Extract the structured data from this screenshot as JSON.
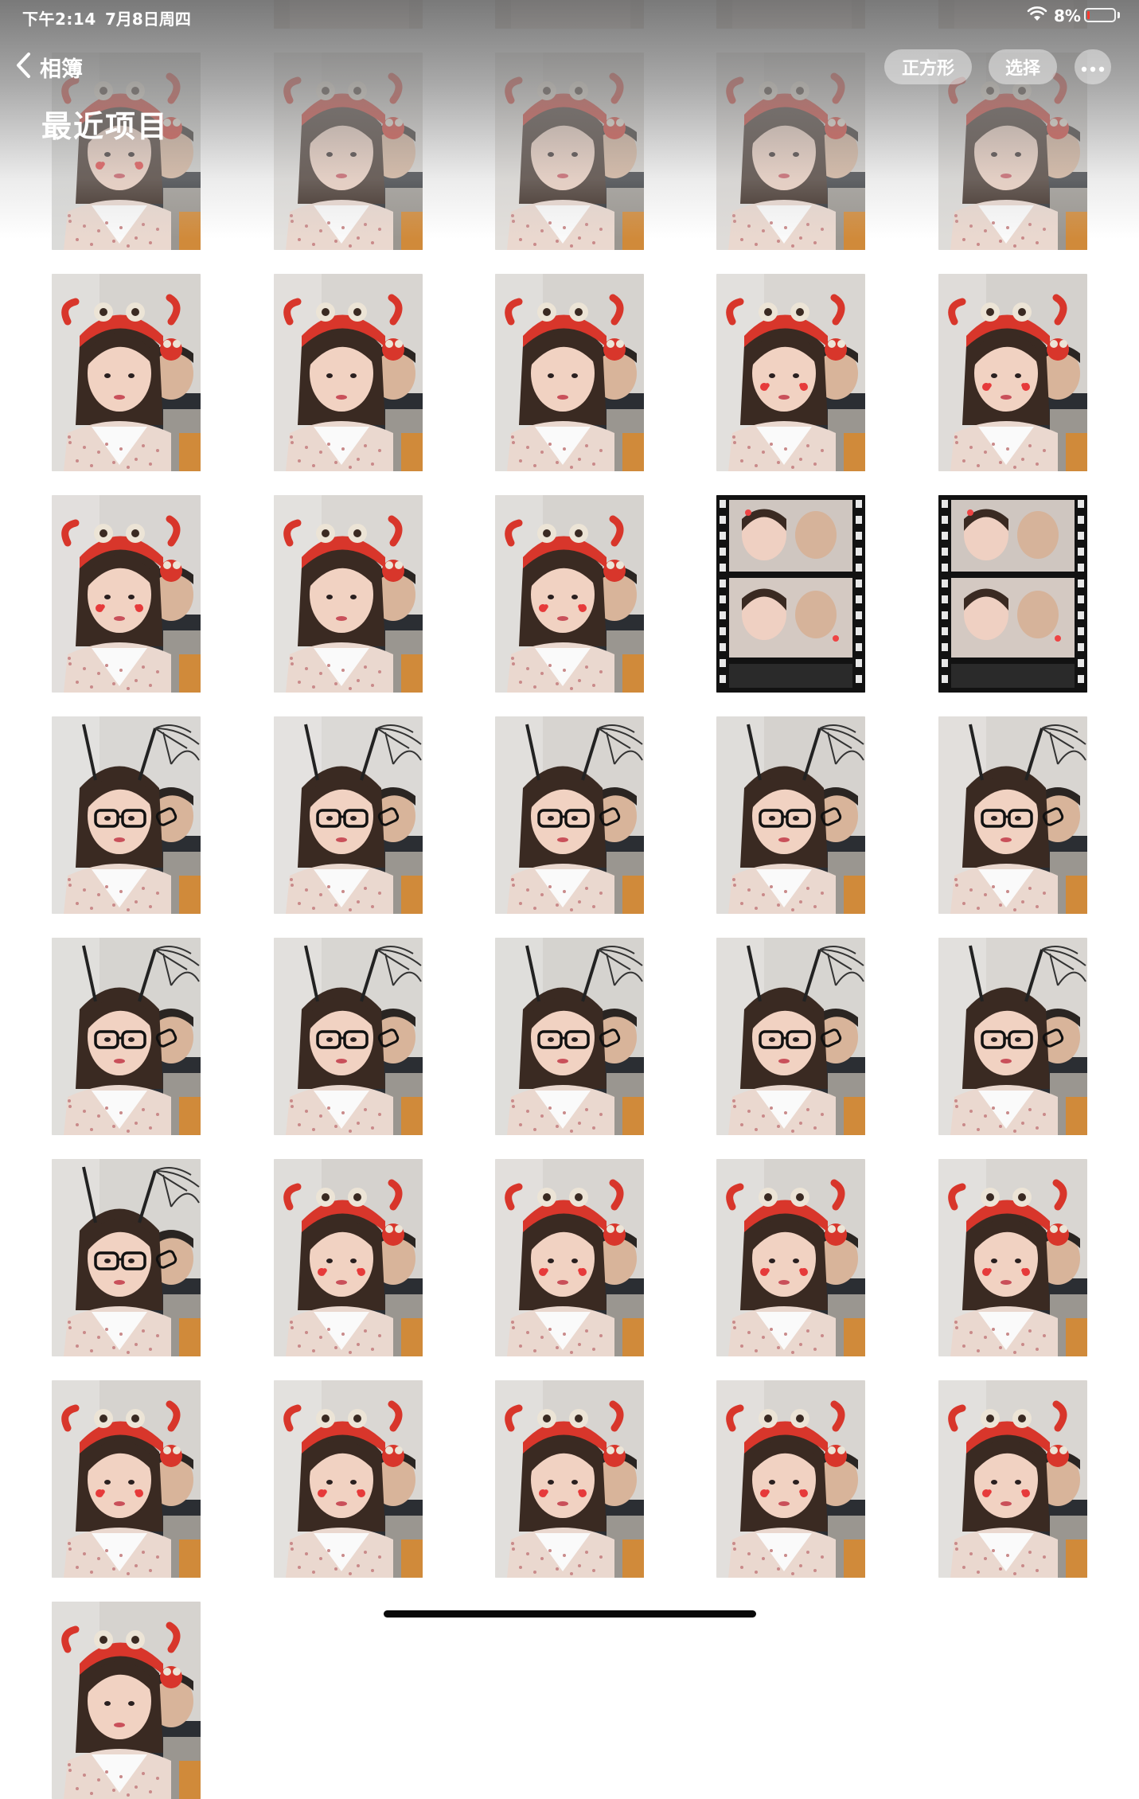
{
  "status_bar": {
    "time": "下午2:14",
    "date": "7月8日周四",
    "battery": "8%",
    "wifi_icon": "wifi-icon",
    "battery_icon": "battery-icon",
    "battery_level": 0.08
  },
  "nav": {
    "back_label": "相簿",
    "back_icon": "chevron-left-icon",
    "title": "最近项目",
    "square_label": "正方形",
    "select_label": "选择",
    "more_icon": "ellipsis-icon"
  },
  "photos": [
    {
      "style": "crab-cheeks",
      "bg": "#cfcfcc"
    },
    {
      "style": "crab",
      "bg": "#d9d6d2"
    },
    {
      "style": "crab",
      "bg": "#d8d4cf"
    },
    {
      "style": "crab",
      "bg": "#d4d1cd"
    },
    {
      "style": "crab",
      "bg": "#d3d0cc"
    },
    {
      "style": "crab",
      "bg": "#d6d3cf"
    },
    {
      "style": "crab",
      "bg": "#d8d5d1"
    },
    {
      "style": "crab",
      "bg": "#d6d3cf"
    },
    {
      "style": "crab-cheeks",
      "bg": "#d9d6d2"
    },
    {
      "style": "crab-cheeks",
      "bg": "#d4d1cd"
    },
    {
      "style": "crab-cheeks",
      "bg": "#d8d5d2"
    },
    {
      "style": "crab",
      "bg": "#dad7d3"
    },
    {
      "style": "crab-cheeks",
      "bg": "#d6d3cf"
    },
    {
      "style": "film",
      "bg": "#111111"
    },
    {
      "style": "film",
      "bg": "#111111"
    },
    {
      "style": "glasses",
      "bg": "#d9d7d4"
    },
    {
      "style": "glasses",
      "bg": "#dbd9d6"
    },
    {
      "style": "glasses",
      "bg": "#d7d4d0"
    },
    {
      "style": "glasses",
      "bg": "#d5d2ce"
    },
    {
      "style": "glasses",
      "bg": "#d8d5d1"
    },
    {
      "style": "glasses",
      "bg": "#d6d4d0"
    },
    {
      "style": "glasses",
      "bg": "#d8d6d2"
    },
    {
      "style": "glasses",
      "bg": "#d5d3cf"
    },
    {
      "style": "glasses",
      "bg": "#d7d5d1"
    },
    {
      "style": "glasses",
      "bg": "#d9d6d2"
    },
    {
      "style": "glasses",
      "bg": "#d7d5d1"
    },
    {
      "style": "crab-cheeks",
      "bg": "#d5d2ce"
    },
    {
      "style": "crab-cheeks",
      "bg": "#d8d5d1"
    },
    {
      "style": "crab-cheeks",
      "bg": "#d6d3cf"
    },
    {
      "style": "crab-cheeks",
      "bg": "#d9d6d2"
    },
    {
      "style": "crab-cheeks",
      "bg": "#d6d3cf"
    },
    {
      "style": "crab-cheeks",
      "bg": "#dad7d3"
    },
    {
      "style": "crab-cheeks",
      "bg": "#d7d4d0"
    },
    {
      "style": "crab-cheeks",
      "bg": "#d8d5d1"
    },
    {
      "style": "crab-cheeks",
      "bg": "#d9d6d2"
    },
    {
      "style": "crab",
      "bg": "#d6d3cf"
    }
  ]
}
